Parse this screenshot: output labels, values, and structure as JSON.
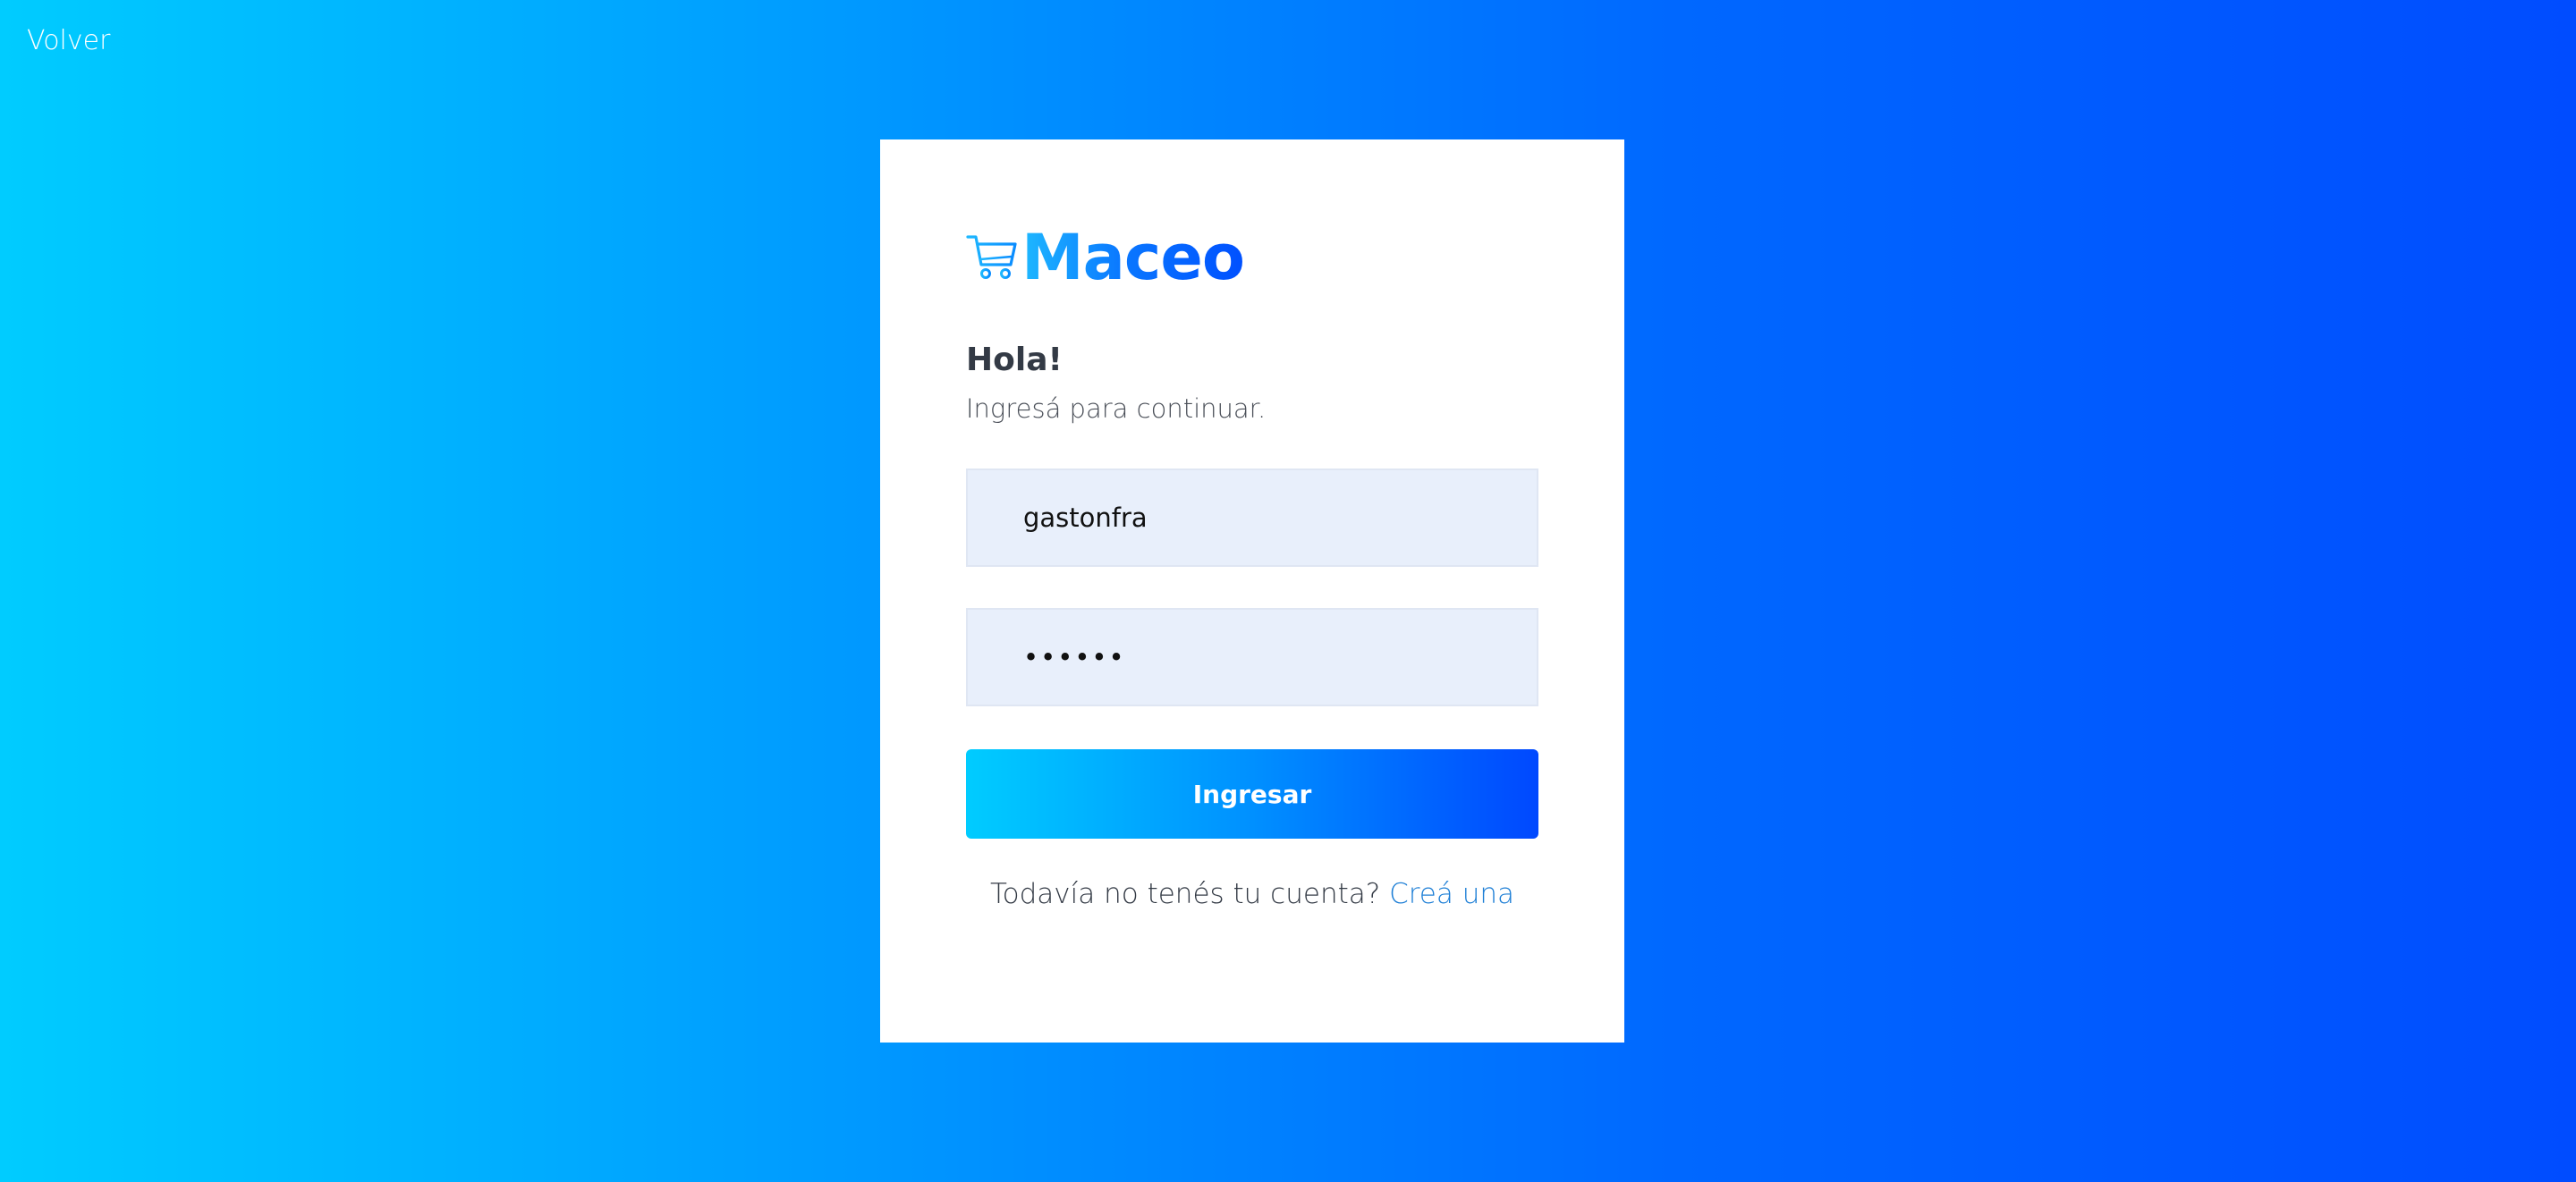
{
  "nav": {
    "back_label": "Volver"
  },
  "brand": {
    "name": "Maceo",
    "icon": "cart-icon"
  },
  "login": {
    "greeting": "Hola!",
    "subtitle": "Ingresá para continuar.",
    "username_value": "gastonfra",
    "password_value": "••••••",
    "submit_label": "Ingresar",
    "signup_prompt": "Todavía no tenés tu cuenta?",
    "signup_link": "Creá una"
  },
  "colors": {
    "gradient_start": "#00ccff",
    "gradient_end": "#004cff",
    "input_background": "#e8effb",
    "link": "#1e7fd6"
  }
}
